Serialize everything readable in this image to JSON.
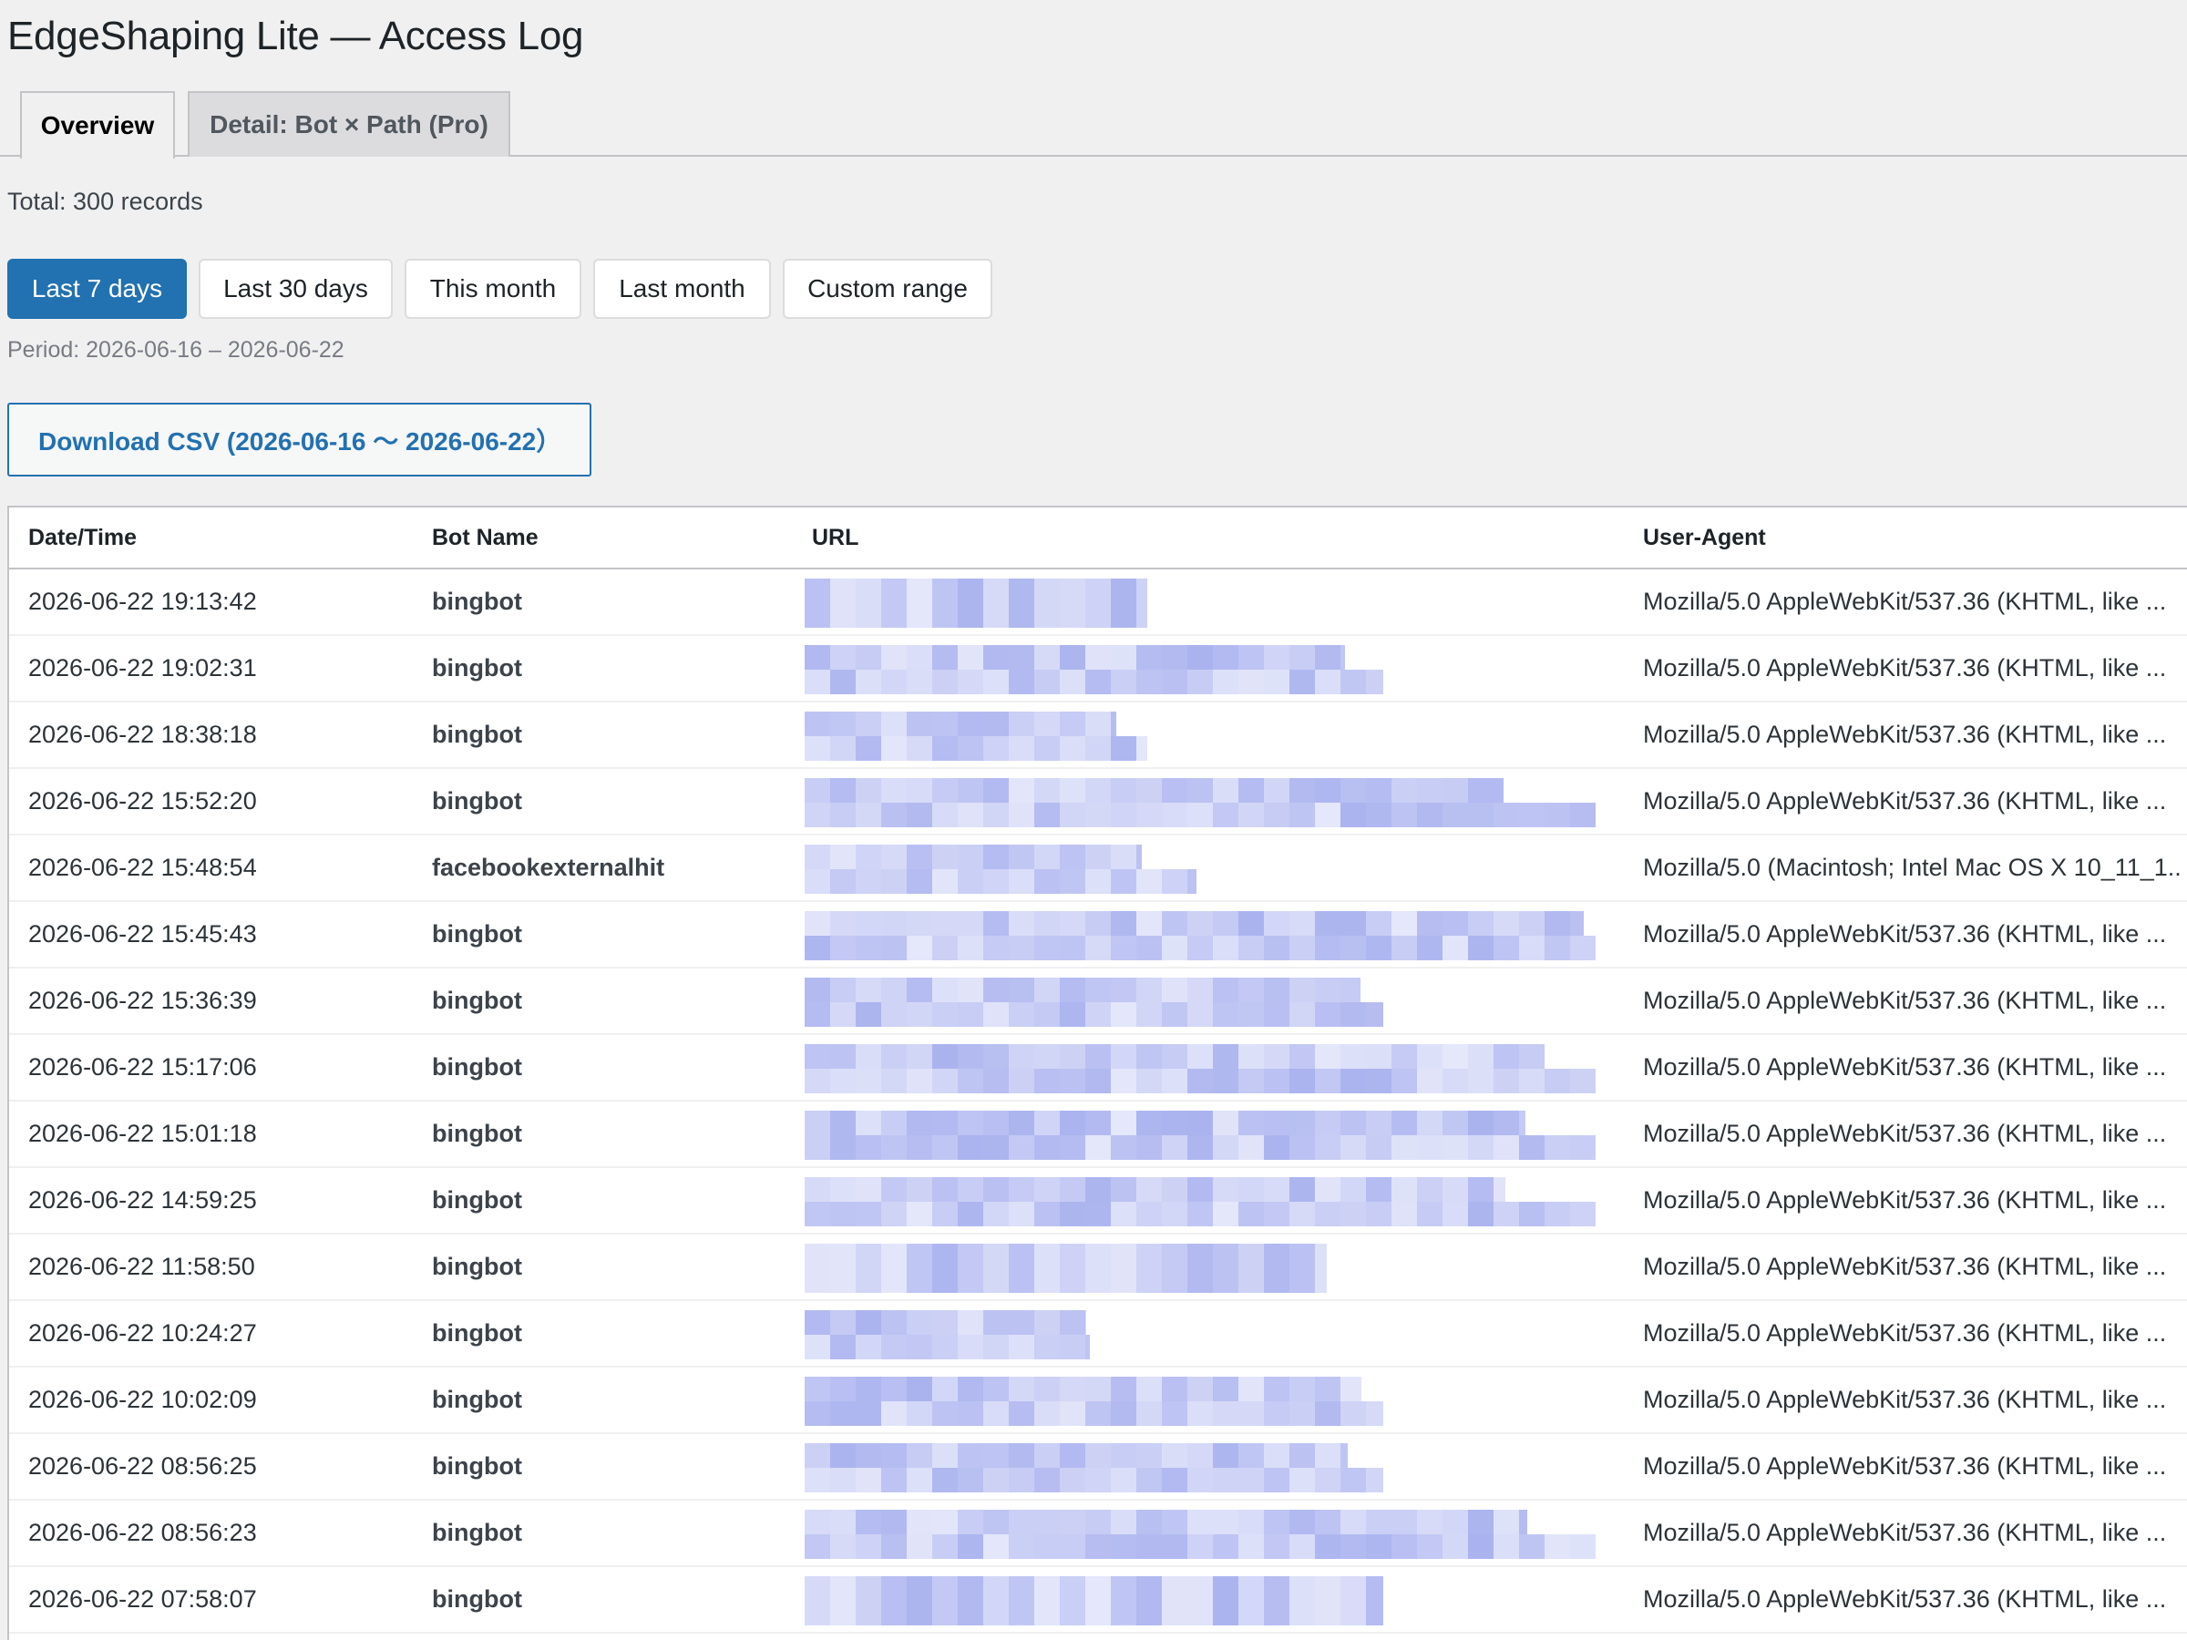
{
  "page_title": "EdgeShaping Lite — Access Log",
  "tabs": [
    {
      "label": "Overview",
      "active": true
    },
    {
      "label": "Detail: Bot × Path (Pro)",
      "active": false
    }
  ],
  "total_label": "Total: 300 records",
  "ranges": [
    {
      "label": "Last 7 days",
      "active": true
    },
    {
      "label": "Last 30 days",
      "active": false
    },
    {
      "label": "This month",
      "active": false
    },
    {
      "label": "Last month",
      "active": false
    },
    {
      "label": "Custom range",
      "active": false
    }
  ],
  "period_label": "Period: 2026-06-16 – 2026-06-22",
  "csv_button_label": "Download CSV (2026-06-16 〜 2026-06-22）",
  "table": {
    "headers": [
      "Date/Time",
      "Bot Name",
      "URL",
      "User-Agent"
    ],
    "rows": [
      {
        "datetime": "2026-06-22 19:13:42",
        "bot": "bingbot",
        "url_len": 0.42,
        "url_lines": 1,
        "ua": "Mozilla/5.0 AppleWebKit/537.36 (KHTML, like ..."
      },
      {
        "datetime": "2026-06-22 19:02:31",
        "bot": "bingbot",
        "url_len": 0.71,
        "url_lines": 2,
        "ua": "Mozilla/5.0 AppleWebKit/537.36 (KHTML, like ..."
      },
      {
        "datetime": "2026-06-22 18:38:18",
        "bot": "bingbot",
        "url_len": 0.42,
        "url_lines": 2,
        "ua": "Mozilla/5.0 AppleWebKit/537.36 (KHTML, like ..."
      },
      {
        "datetime": "2026-06-22 15:52:20",
        "bot": "bingbot",
        "url_len": 0.97,
        "url_lines": 2,
        "ua": "Mozilla/5.0 AppleWebKit/537.36 (KHTML, like ..."
      },
      {
        "datetime": "2026-06-22 15:48:54",
        "bot": "facebookexternalhit",
        "url_len": 0.48,
        "url_lines": 2,
        "ua": "Mozilla/5.0 (Macintosh; Intel Mac OS X 10_11_1..."
      },
      {
        "datetime": "2026-06-22 15:45:43",
        "bot": "bingbot",
        "url_len": 0.97,
        "url_lines": 2,
        "ua": "Mozilla/5.0 AppleWebKit/537.36 (KHTML, like ..."
      },
      {
        "datetime": "2026-06-22 15:36:39",
        "bot": "bingbot",
        "url_len": 0.71,
        "url_lines": 2,
        "ua": "Mozilla/5.0 AppleWebKit/537.36 (KHTML, like ..."
      },
      {
        "datetime": "2026-06-22 15:17:06",
        "bot": "bingbot",
        "url_len": 0.97,
        "url_lines": 2,
        "ua": "Mozilla/5.0 AppleWebKit/537.36 (KHTML, like ..."
      },
      {
        "datetime": "2026-06-22 15:01:18",
        "bot": "bingbot",
        "url_len": 0.97,
        "url_lines": 2,
        "ua": "Mozilla/5.0 AppleWebKit/537.36 (KHTML, like ..."
      },
      {
        "datetime": "2026-06-22 14:59:25",
        "bot": "bingbot",
        "url_len": 0.97,
        "url_lines": 2,
        "ua": "Mozilla/5.0 AppleWebKit/537.36 (KHTML, like ..."
      },
      {
        "datetime": "2026-06-22 11:58:50",
        "bot": "bingbot",
        "url_len": 0.64,
        "url_lines": 1,
        "ua": "Mozilla/5.0 AppleWebKit/537.36 (KHTML, like ..."
      },
      {
        "datetime": "2026-06-22 10:24:27",
        "bot": "bingbot",
        "url_len": 0.35,
        "url_lines": 2,
        "ua": "Mozilla/5.0 AppleWebKit/537.36 (KHTML, like ..."
      },
      {
        "datetime": "2026-06-22 10:02:09",
        "bot": "bingbot",
        "url_len": 0.71,
        "url_lines": 2,
        "ua": "Mozilla/5.0 AppleWebKit/537.36 (KHTML, like ..."
      },
      {
        "datetime": "2026-06-22 08:56:25",
        "bot": "bingbot",
        "url_len": 0.71,
        "url_lines": 2,
        "ua": "Mozilla/5.0 AppleWebKit/537.36 (KHTML, like ..."
      },
      {
        "datetime": "2026-06-22 08:56:23",
        "bot": "bingbot",
        "url_len": 0.97,
        "url_lines": 2,
        "ua": "Mozilla/5.0 AppleWebKit/537.36 (KHTML, like ..."
      },
      {
        "datetime": "2026-06-22 07:58:07",
        "bot": "bingbot",
        "url_len": 0.71,
        "url_lines": 1,
        "ua": "Mozilla/5.0 AppleWebKit/537.36 (KHTML, like ..."
      }
    ]
  },
  "colors": {
    "primary": "#2271b1",
    "url_blur": "#c9cdf5"
  }
}
